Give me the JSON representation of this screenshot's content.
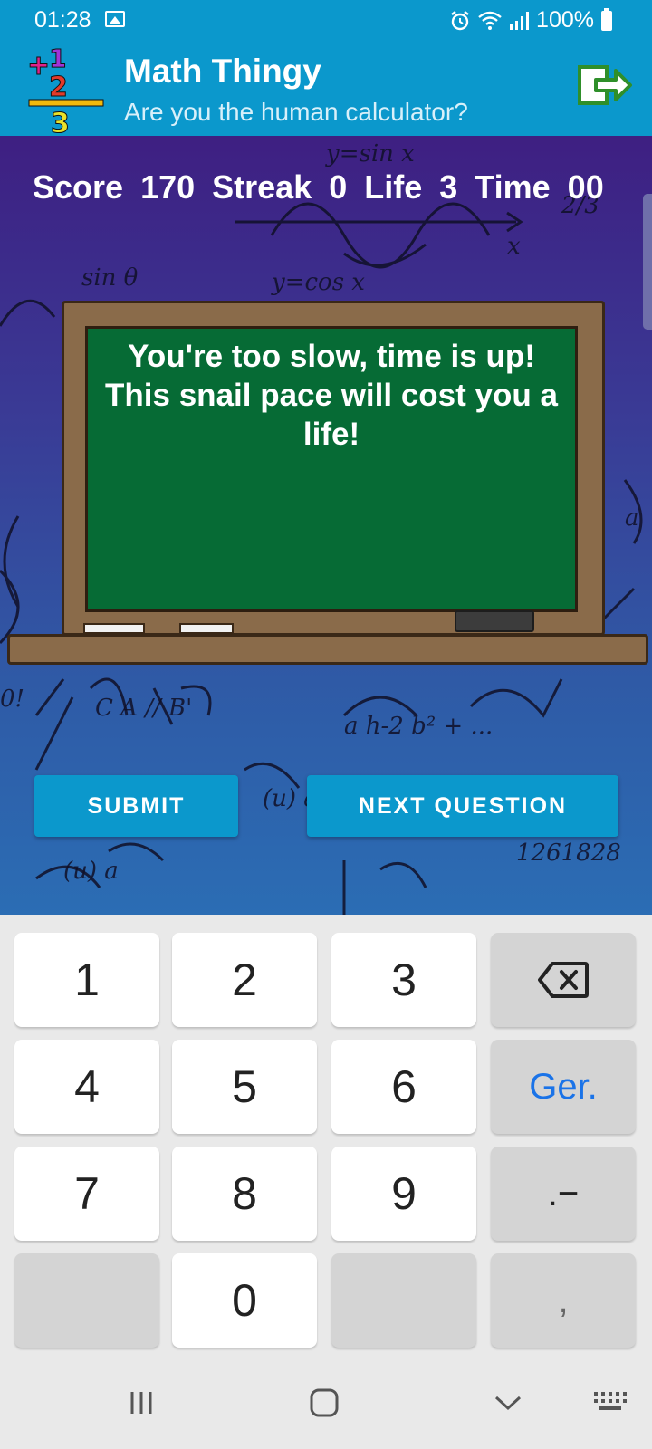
{
  "status_bar": {
    "time": "01:28",
    "battery": "100%",
    "icons": [
      "image-icon",
      "alarm-icon",
      "wifi-icon",
      "signal-icon",
      "battery-icon"
    ]
  },
  "app_bar": {
    "title": "Math Thingy",
    "subtitle": "Are you the human calculator?",
    "exit_icon": "exit-icon",
    "accent_color": "#0b98cc"
  },
  "game": {
    "scorebar": {
      "score_label": "Score",
      "score_value": "170",
      "streak_label": "Streak",
      "streak_value": "0",
      "life_label": "Life",
      "life_value": "3",
      "time_label": "Time",
      "time_value": "00"
    },
    "board_message": "You're too slow, time is up! This snail pace will cost you a life!",
    "buttons": {
      "submit": "SUBMIT",
      "next": "NEXT QUESTION"
    }
  },
  "keyboard": {
    "keys": {
      "k1": "1",
      "k2": "2",
      "k3": "3",
      "k4": "4",
      "k5": "5",
      "k6": "6",
      "k7": "7",
      "k8": "8",
      "k9": "9",
      "k0": "0",
      "go": "Ger.",
      "dot_minus": ".−",
      "comma": ","
    },
    "backspace_icon": "backspace-icon"
  },
  "nav_bar": {
    "icons": [
      "recent-apps-icon",
      "home-icon",
      "hide-keyboard-icon",
      "keyboard-icon"
    ]
  }
}
